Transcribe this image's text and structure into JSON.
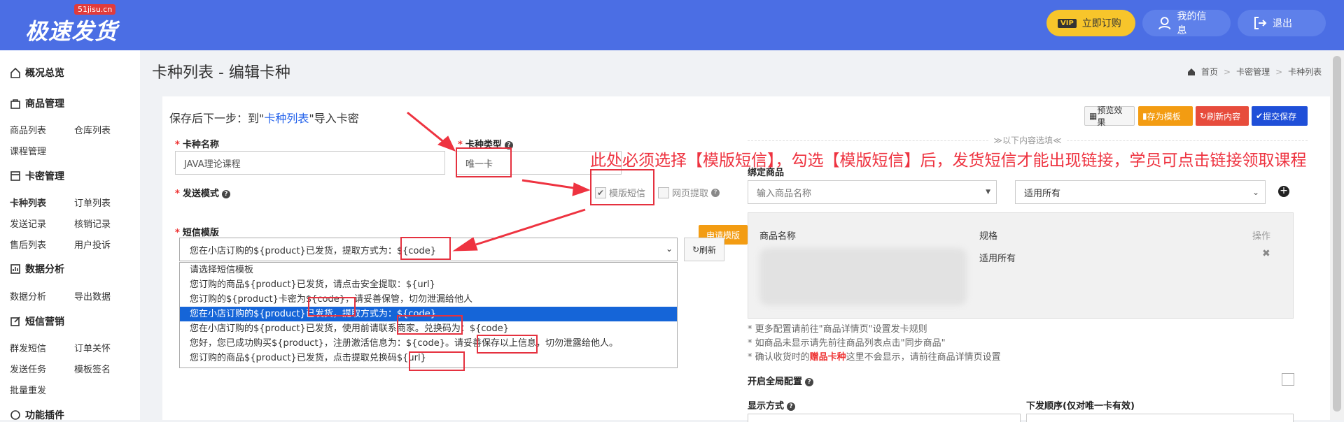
{
  "brand": {
    "logo_text": "极速发货",
    "badge": "51jisu.cn"
  },
  "topbar": {
    "vip_badge": "VIP",
    "order_label": "立即订购",
    "myinfo_label": "我的信息",
    "logout_label": "退出"
  },
  "sidebar": {
    "overview": "概况总览",
    "goods_group": "商品管理",
    "goods_list": "商品列表",
    "warehouse_list": "仓库列表",
    "course_mgmt": "课程管理",
    "card_group": "卡密管理",
    "card_types": "卡种列表",
    "order_list": "订单列表",
    "send_records": "发送记录",
    "verify_records": "核销记录",
    "after_sales": "售后列表",
    "user_complaints": "用户投诉",
    "data_group": "数据分析",
    "data_analysis": "数据分析",
    "export_data": "导出数据",
    "sms_group": "短信营销",
    "mass_sms": "群发短信",
    "order_care": "订单关怀",
    "send_tasks": "发送任务",
    "template_sign": "模板签名",
    "batch_resend": "批量重发",
    "plugins_group": "功能插件"
  },
  "page": {
    "title": "卡种列表 - 编辑卡种",
    "breadcrumb": [
      "首页",
      ">",
      "卡密管理",
      ">",
      "卡种列表"
    ]
  },
  "form": {
    "next_step_prefix": "保存后下一步：到\"",
    "next_step_link": "卡种列表",
    "next_step_suffix": "\"导入卡密",
    "btn_preview": "预览效果",
    "btn_save_template": "存为模板",
    "btn_refresh_content": "刷新内容",
    "btn_submit": "提交保存",
    "card_name_label": "卡种名称",
    "card_name_value": "JAVA理论课程",
    "card_type_label": "卡种类型",
    "card_type_value": "唯一卡",
    "send_mode_label": "发送模式",
    "sms_template_option": "模版短信",
    "web_extract_option": "网页提取",
    "sms_template_label": "短信模版",
    "apply_template_btn": "申请模版",
    "refresh_btn": "刷新",
    "selected_template": "您在小店订购的${product}已发货，提取方式为：${code}",
    "template_options": [
      "请选择短信模板",
      "您订购的商品${product}已发货，请点击安全提取：${url}",
      "您订购的${product}卡密为${code}，请妥善保管，切勿泄漏给他人",
      "您在小店订购的${product}已发货，提取方式为：${code}",
      "您在小店订购的${product}已发货，使用前请联系商家。兑换码为：${code}",
      "您好，您已成功购买${product}，注册激活信息为：${code}。请妥善保存以上信息，切勿泄露给他人。",
      "您订购的商品${product}已发货，点击提取兑换码${url}"
    ],
    "selected_index": 3
  },
  "annotation": "此处必须选择【模版短信】，勾选【模版短信】后，发货短信才能出现链接，学员可点击链接领取课程",
  "right": {
    "divider_text": "≫以下内容选填≪",
    "bind_goods_label": "绑定商品",
    "goods_input_placeholder": "输入商品名称",
    "spec_select_value": "适用所有",
    "col_goods_name": "商品名称",
    "col_spec": "规格",
    "col_action": "操作",
    "row_spec": "适用所有",
    "note1": "* 更多配置请前往\"商品详情页\"设置发卡规则",
    "note2": "* 如商品未显示请先前往商品列表点击\"同步商品\"",
    "note3_prefix": "* 确认收货时的",
    "note3_bold": "赠品卡种",
    "note3_suffix": "这里不会显示，请前往商品详情页设置",
    "global_config_label": "开启全局配置",
    "display_mode_label": "显示方式",
    "issue_order_label": "下发顺序(仅对唯一卡有效)"
  },
  "colors": {
    "topbar": "#4b6ee4",
    "vip": "#f7c52b",
    "annotation_red": "#ee3340",
    "selected_row": "#1565d8"
  }
}
